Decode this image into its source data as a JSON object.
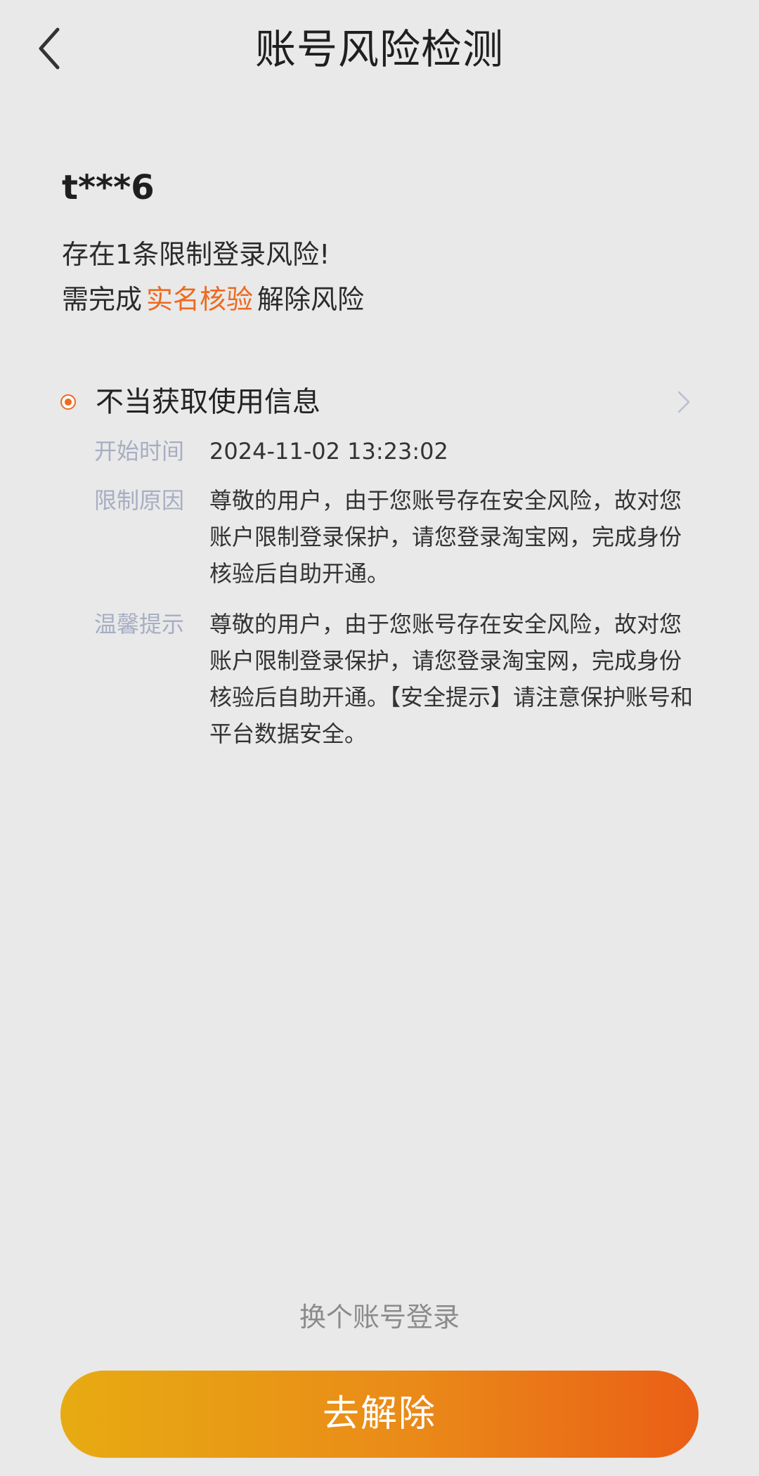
{
  "header": {
    "title": "账号风险检测",
    "back_icon": "chevron-left-icon"
  },
  "account": {
    "masked_name": "t***6",
    "risk_line_1": "存在1条限制登录风险!",
    "risk_line_2_prefix": "需完成",
    "risk_line_2_highlight": "实名核验",
    "risk_line_2_suffix": "解除风险"
  },
  "risk_item": {
    "title": "不当获取使用信息",
    "details": [
      {
        "label": "开始时间",
        "value": "2024-11-02 13:23:02"
      },
      {
        "label": "限制原因",
        "value": "尊敬的用户，由于您账号存在安全风险，故对您账户限制登录保护，请您登录淘宝网，完成身份核验后自助开通。"
      },
      {
        "label": "温馨提示",
        "value": "尊敬的用户，由于您账号存在安全风险，故对您账户限制登录保护，请您登录淘宝网，完成身份核验后自助开通。【安全提示】请注意保护账号和平台数据安全。"
      }
    ]
  },
  "actions": {
    "switch_account": "换个账号登录",
    "resolve": "去解除"
  },
  "colors": {
    "background": "#e9e9e9",
    "accent": "#ee6a1f",
    "label": "#a7aec3",
    "button_gradient_start": "#e7ab12",
    "button_gradient_end": "#ea5f16"
  }
}
